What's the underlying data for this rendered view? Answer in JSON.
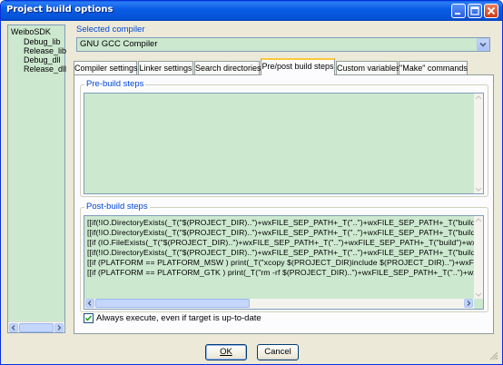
{
  "window": {
    "title": "Project build options"
  },
  "titlebar_buttons": [
    {
      "name": "minimize-button",
      "icon": "minimize-icon"
    },
    {
      "name": "maximize-button",
      "icon": "maximize-icon"
    },
    {
      "name": "close-button",
      "icon": "close-icon"
    }
  ],
  "tree": {
    "root": "WeiboSDK",
    "items": [
      "Debug_lib",
      "Release_lib",
      "Debug_dll",
      "Release_dll"
    ]
  },
  "compiler": {
    "label": "Selected compiler",
    "value": "GNU GCC Compiler"
  },
  "tabs": [
    {
      "label": "Compiler settings",
      "active": false
    },
    {
      "label": "Linker settings",
      "active": false
    },
    {
      "label": "Search directories",
      "active": false
    },
    {
      "label": "Pre/post build steps",
      "active": true
    },
    {
      "label": "Custom variables",
      "active": false
    },
    {
      "label": "\"Make\" commands",
      "active": false
    }
  ],
  "pre_build": {
    "label": "Pre-build steps",
    "lines": []
  },
  "post_build": {
    "label": "Post-build steps",
    "lines": [
      "[[if(!IO.DirectoryExists(_T(\"$(PROJECT_DIR)..\")+wxFILE_SEP_PATH+_T(\"..\")+wxFILE_SEP_PATH+_T(\"build\")+w",
      "[[if(!IO.DirectoryExists(_T(\"$(PROJECT_DIR)..\")+wxFILE_SEP_PATH+_T(\"..\")+wxFILE_SEP_PATH+_T(\"build\")+w",
      "[[if (IO.FileExists(_T(\"$(PROJECT_DIR)..\")+wxFILE_SEP_PATH+_T(\"..\")+wxFILE_SEP_PATH+_T(\"build\")+wxFILE",
      "[[if(!IO.DirectoryExists(_T(\"$(PROJECT_DIR)..\")+wxFILE_SEP_PATH+_T(\"..\")+wxFILE_SEP_PATH+_T(\"build\")+w",
      "[[if (PLATFORM == PLATFORM_MSW ) print(_T(\"xcopy $(PROJECT_DIR)include $(PROJECT_DIR)..\")+wxFILE_SE",
      "[[if (PLATFORM == PLATFORM_GTK ) print(_T(\"rm -rf $(PROJECT_DIR)..\")+wxFILE_SEP_PATH+_T(\"..\")+wxFILE_"
    ]
  },
  "always_execute": {
    "label": "Always execute, even if target is up-to-date",
    "checked": true
  },
  "buttons": {
    "ok": "OK",
    "cancel": "Cancel"
  },
  "colors": {
    "accent": "#0046d5",
    "titlebar": "#0a5ee8",
    "field_bg": "#cce8cf",
    "tab_highlight": "#ffc83c"
  }
}
